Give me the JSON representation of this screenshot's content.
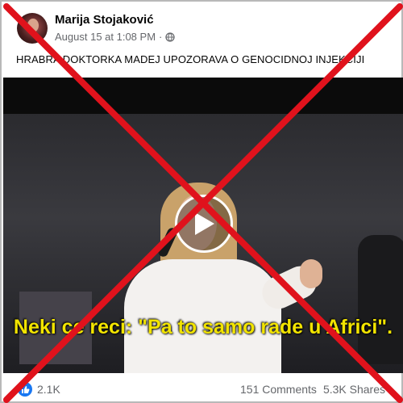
{
  "post": {
    "author": "Marija Stojaković",
    "timestamp": "August 15 at 1:08 PM",
    "separator": "·",
    "privacy_icon": "globe-icon",
    "caption": "HRABRA DOKTORKA MADEJ UPOZORAVA O GENOCIDNOJ INJEKCIJI"
  },
  "video": {
    "subtitle": "Neki ce reci: \"Pa to samo rade u Africi\".",
    "play_icon": "play-icon"
  },
  "footer": {
    "like_icon": "like-icon",
    "reaction_count": "2.1K",
    "comments": "151 Comments",
    "shares": "5.3K Shares"
  },
  "overlay": {
    "mark": "false-information-cross",
    "color": "#e0121c"
  }
}
